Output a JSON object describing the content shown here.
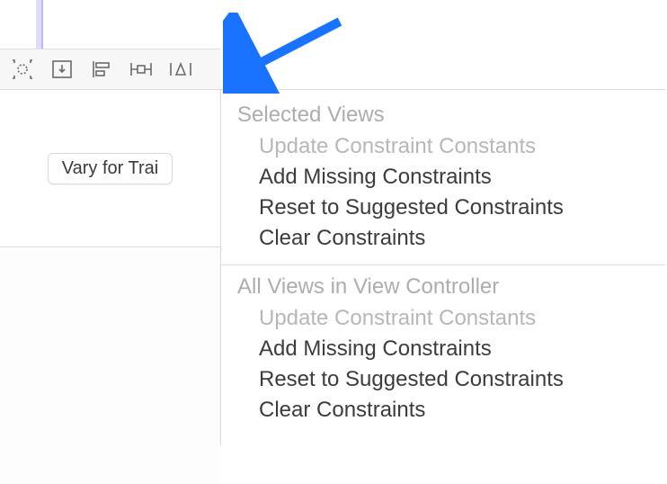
{
  "toolbar": {
    "vary_for_traits_label": "Vary for Trai"
  },
  "menu": {
    "section1": {
      "header": "Selected Views",
      "items": [
        {
          "label": "Update Constraint Constants",
          "enabled": false
        },
        {
          "label": "Add Missing Constraints",
          "enabled": true
        },
        {
          "label": "Reset to Suggested Constraints",
          "enabled": true
        },
        {
          "label": "Clear Constraints",
          "enabled": true
        }
      ]
    },
    "section2": {
      "header": "All Views in View Controller",
      "items": [
        {
          "label": "Update Constraint Constants",
          "enabled": false
        },
        {
          "label": "Add Missing Constraints",
          "enabled": true
        },
        {
          "label": "Reset to Suggested Constraints",
          "enabled": true
        },
        {
          "label": "Clear Constraints",
          "enabled": true
        }
      ]
    }
  },
  "annotation": {
    "arrow_color": "#1a73ff"
  }
}
